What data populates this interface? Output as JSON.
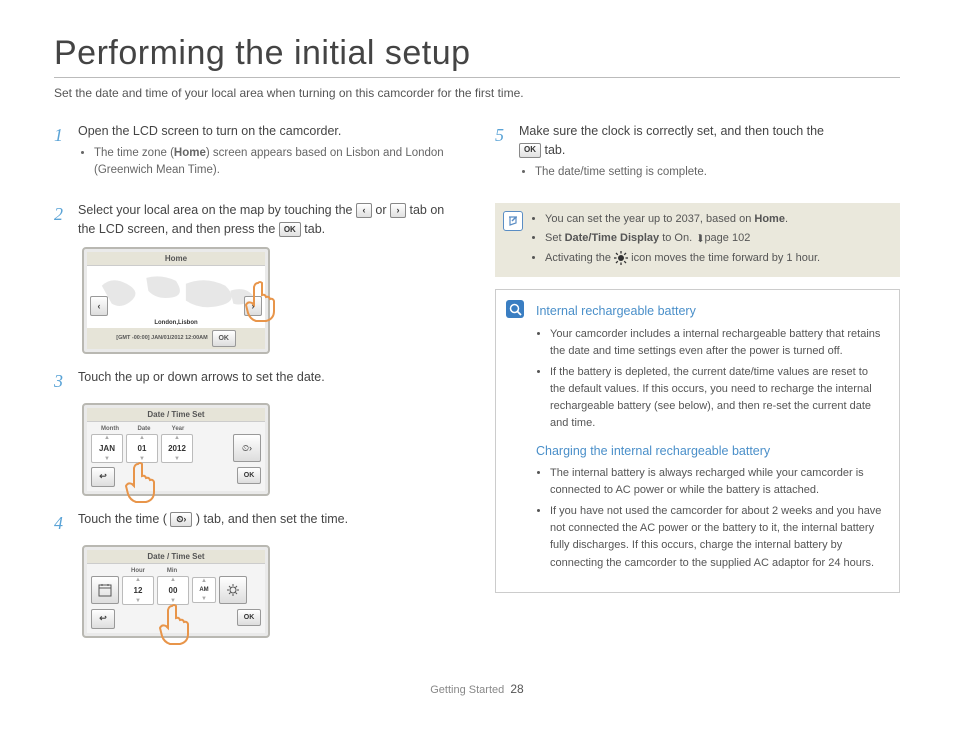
{
  "title": "Performing the initial setup",
  "subtitle": "Set the date and time of your local area when turning on this camcorder for the first time.",
  "steps": {
    "1": {
      "text": "Open the LCD screen to turn on the camcorder.",
      "bullet_pre": "The time zone (",
      "bullet_bold": "Home",
      "bullet_post": ") screen appears based on Lisbon and London (Greenwich Mean Time)."
    },
    "2": {
      "pre": "Select your local area on the map by touching the ",
      "mid": " or ",
      "post1": " tab on the LCD screen, and then press the ",
      "post2": " tab."
    },
    "3": {
      "text": "Touch the up or down arrows to set the date."
    },
    "4": {
      "pre": "Touch the time ( ",
      "post": " ) tab, and then set the time."
    },
    "5": {
      "pre": "Make sure the clock is correctly set, and then touch the ",
      "post": " tab.",
      "bullet": "The date/time setting is complete."
    }
  },
  "icons": {
    "left": "‹",
    "right": "›",
    "ok": "OK",
    "back": "↩",
    "clock": "⏲›",
    "cal": "📅"
  },
  "device_map": {
    "header": "Home",
    "city": "London,Lisbon",
    "stamp": "[GMT -00:00] JAN/01/2012 12:00AM",
    "ok": "OK"
  },
  "device_date": {
    "header": "Date / Time Set",
    "labels": {
      "month": "Month",
      "date": "Date",
      "year": "Year"
    },
    "values": {
      "month": "JAN",
      "date": "01",
      "year": "2012"
    },
    "ok": "OK"
  },
  "device_time": {
    "header": "Date / Time Set",
    "labels": {
      "hour": "Hour",
      "min": "Min"
    },
    "values": {
      "hour": "12",
      "min": "00",
      "ampm": "AM"
    },
    "ok": "OK"
  },
  "notes": {
    "n1_pre": "You can set the year up to 2037, based on ",
    "n1_bold": "Home",
    "n1_post": ".",
    "n2_pre": "Set ",
    "n2_bold": "Date/Time Display",
    "n2_post": " to On. ",
    "n2_ref": "page 102",
    "n3_pre": "Activating the ",
    "n3_post": " icon moves the time forward by 1 hour."
  },
  "info": {
    "h1": "Internal rechargeable battery",
    "h1_b1": "Your camcorder includes a internal rechargeable battery that retains the date and time settings even after the power is turned off.",
    "h1_b2": "If the battery is depleted, the current date/time values are reset to the default values. If this occurs, you need to recharge the internal rechargeable battery (see below), and then re-set the current date and time.",
    "h2": "Charging the internal rechargeable battery",
    "h2_b1": "The internal battery is always recharged while your camcorder is connected to AC power or while the battery is attached.",
    "h2_b2": "If you have not used the camcorder for about 2 weeks and you have not connected the AC power or the battery to it, the internal battery fully discharges. If this occurs, charge the internal battery by connecting the camcorder to the supplied AC adaptor for 24 hours."
  },
  "footer": {
    "section": "Getting Started",
    "page": "28"
  }
}
